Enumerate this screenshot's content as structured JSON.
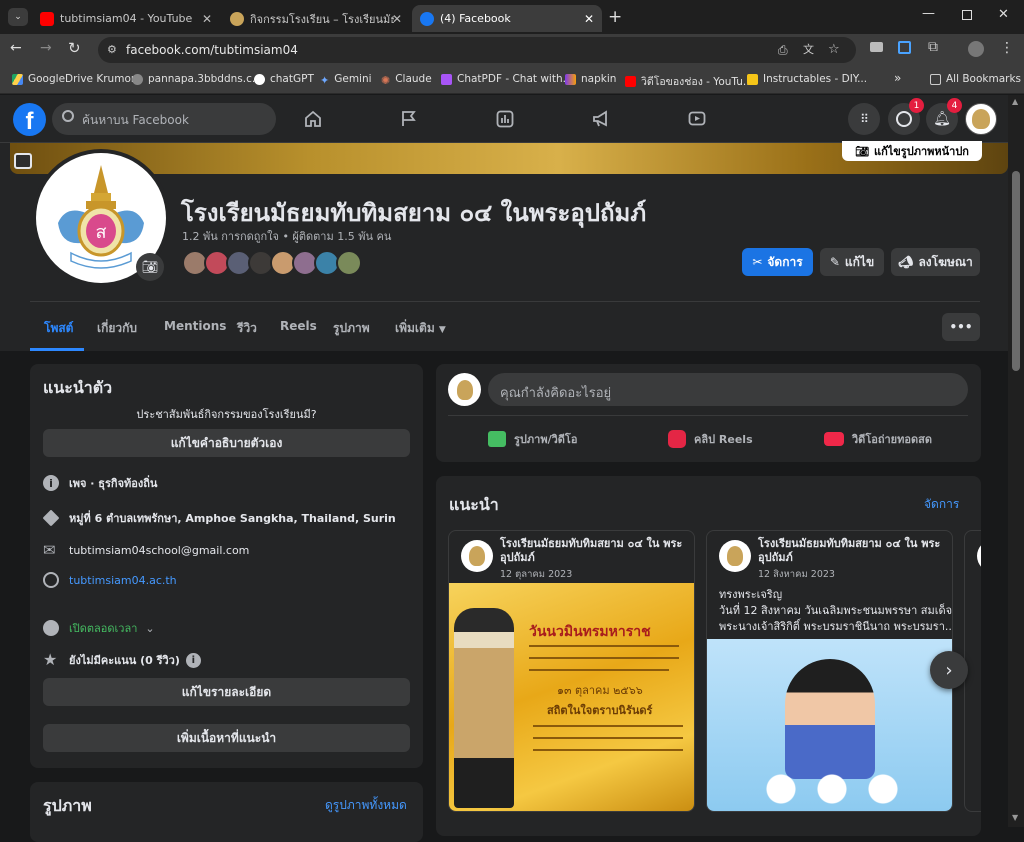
{
  "browser": {
    "tabs": [
      {
        "title": "tubtimsiam04 - YouTube",
        "active": false
      },
      {
        "title": "กิจกรรมโรงเรียน – โรงเรียนมัธยมทับทิ",
        "active": false
      },
      {
        "title": "(4) Facebook",
        "active": true
      }
    ],
    "url": "facebook.com/tubtimsiam04",
    "bookmarks": [
      "GoogleDrive Krumon",
      "pannapa.3bbddns.c...",
      "chatGPT",
      "Gemini",
      "Claude",
      "ChatPDF - Chat with...",
      "napkin",
      "วิดีโอของช่อง - YouTu...",
      "Instructables - DIY...",
      "»",
      "All Bookmarks"
    ],
    "colors": {
      "accent": "#1b74e4"
    }
  },
  "fbnav": {
    "search_placeholder": "ค้นหาบน Facebook",
    "messenger_badge": "1",
    "notif_badge": "4"
  },
  "cover": {
    "edit_cover": "แก้ไขรูปภาพหน้าปก"
  },
  "profile": {
    "name": "โรงเรียนมัธยมทับทิมสยาม ๐๔ ในพระอุปถัมภ์",
    "stats": "1.2 พัน การกดถูกใจ • ผู้ติดตาม 1.5 พัน คน",
    "manage": "จัดการ",
    "edit": "แก้ไข",
    "advertise": "ลงโฆษณา"
  },
  "page_tabs": [
    "โพสต์",
    "เกี่ยวกับ",
    "Mentions",
    "รีวิว",
    "Reels",
    "รูปภาพ",
    "เพิ่มเติม"
  ],
  "intro": {
    "title": "แนะนำตัว",
    "prompt": "ประชาสัมพันธ์กิจกรรมของโรงเรียนมี?",
    "edit_bio": "แก้ไขคำอธิบายตัวเอง",
    "category": "เพจ · ธุรกิจท้องถิ่น",
    "address": "หมู่ที่ 6 ตำบลเทพรักษา, Amphoe Sangkha, Thailand, Surin",
    "email": "tubtimsiam04school@gmail.com",
    "website": "tubtimsiam04.ac.th",
    "hours": "เปิดตลอดเวลา",
    "rating": "ยังไม่มีคะแนน (0 รีวิว)",
    "edit_details": "แก้ไขรายละเอียด",
    "add_featured": "เพิ่มเนื้อหาที่แนะนำ"
  },
  "photos": {
    "title": "รูปภาพ",
    "see_all": "ดูรูปภาพทั้งหมด"
  },
  "composer": {
    "placeholder": "คุณกำลังคิดอะไรอยู่",
    "photo_video": "รูปภาพ/วิดีโอ",
    "reels": "คลิป Reels",
    "live": "วิดีโอถ่ายทอดสด"
  },
  "featured": {
    "title": "แนะนำ",
    "manage": "จัดการ",
    "posts": [
      {
        "author": "โรงเรียนมัธยมทับทิมสยาม ๐๔ ใน พระอุปถัมภ์",
        "date": "12 ตุลาคม 2023",
        "text": "",
        "banner": "วันนวมินทรมหาราช",
        "banner_sub": "๑๓ ตุลาคม ๒๕๖๖",
        "banner_line": "สถิตในใจตราบนิรันดร์"
      },
      {
        "author": "โรงเรียนมัธยมทับทิมสยาม ๐๔ ใน พระอุปถัมภ์",
        "date": "12 สิงหาคม 2023",
        "text1": "ทรงพระเจริญ",
        "text2": "วันที่ 12 สิงหาคม วันเฉลิมพระชนมพรรษา สมเด็จ",
        "text3": "พระนางเจ้าสิริกิติ์ พระบรมราชินีนาถ พระบรมรา..."
      }
    ]
  }
}
